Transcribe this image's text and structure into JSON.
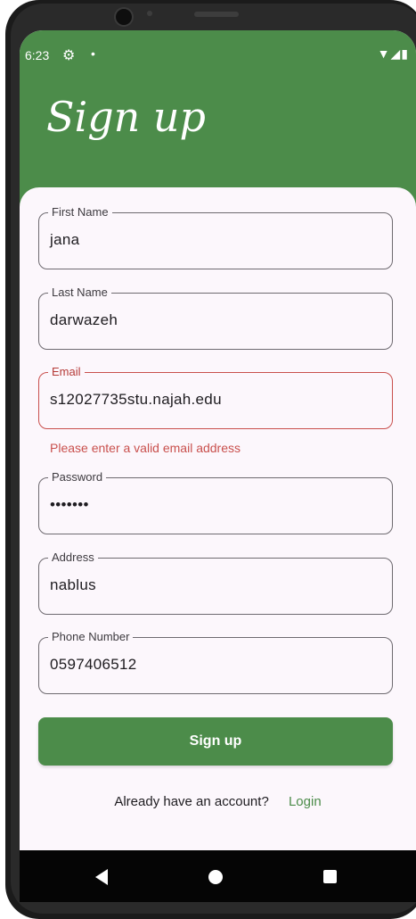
{
  "status_bar": {
    "time": "6:23",
    "left_icons": [
      "settings-gear-icon",
      "notification-dot-icon"
    ],
    "right_icons": [
      "wifi-icon",
      "signal-icon",
      "battery-icon"
    ]
  },
  "header": {
    "title": "Sign up",
    "background_color": "#4c8c4a"
  },
  "form": {
    "fields": [
      {
        "label": "First Name",
        "value": "jana",
        "error": false
      },
      {
        "label": "Last Name",
        "value": "darwazeh",
        "error": false
      },
      {
        "label": "Email",
        "value": "s12027735stu.najah.edu",
        "error": true
      },
      {
        "label": "Password",
        "value": "•••••••",
        "error": false
      },
      {
        "label": "Address",
        "value": "nablus",
        "error": false
      },
      {
        "label": "Phone Number",
        "value": "0597406512",
        "error": false
      }
    ],
    "email_error": "Please enter a valid email address",
    "submit_label": "Sign up",
    "footer_prompt": "Already have an account?",
    "login_link": "Login"
  },
  "colors": {
    "accent": "#4c8c4a",
    "error": "#c9504d"
  },
  "nav_bar": {
    "buttons": [
      "back-icon",
      "home-icon",
      "recent-apps-icon"
    ]
  }
}
